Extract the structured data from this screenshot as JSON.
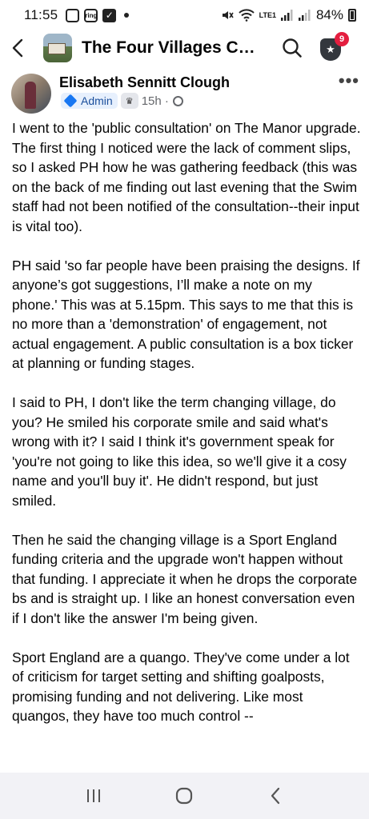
{
  "status_bar": {
    "time": "11:55",
    "battery": "84%",
    "network_label": "LTE1",
    "status_icons": [
      "instagram-icon",
      "ring-icon",
      "check-icon",
      "dot-icon"
    ]
  },
  "header": {
    "title": "The Four Villages Com...",
    "notification_count": "9"
  },
  "post": {
    "author": "Elisabeth Sennitt Clough",
    "role": "Admin",
    "time": "15h ·",
    "paragraphs": [
      "I went to the 'public consultation' on The Manor upgrade. The first thing I noticed were the lack of comment slips, so I asked PH how he was gathering feedback (this was on the back of me finding out last evening that the Swim staff had not been notified of the consultation--their input is vital too).",
      "PH said 'so far people have been praising the designs. If anyone’s got suggestions, I’ll make a note on my phone.' This was at 5.15pm. This says to me that this is no more than a 'demonstration' of engagement, not actual engagement. A public consultation is a box ticker at planning or funding stages.",
      "I said to PH, I don't like the term changing village, do you? He smiled his corporate smile and said what's wrong with it? I said I think it's government speak for 'you're not going to like this idea, so we'll give it a cosy name and you'll buy it'. He didn't respond, but just smiled.",
      "Then he said the changing village is a Sport England funding criteria and the upgrade won't happen without that funding. I appreciate it when he drops the corporate bs and is straight up. I like an honest conversation even if I don't like the answer I'm being given.",
      "Sport England are a quango. They've come under a lot of criticism for target setting and shifting goalposts, promising funding and not delivering. Like most quangos, they have too much control --"
    ]
  },
  "colors": {
    "admin_badge_bg": "#e7f0fd",
    "admin_badge_text": "#1b4f9c",
    "notification_red": "#e41e3f",
    "text": "#050505",
    "meta_gray": "#65676b"
  }
}
